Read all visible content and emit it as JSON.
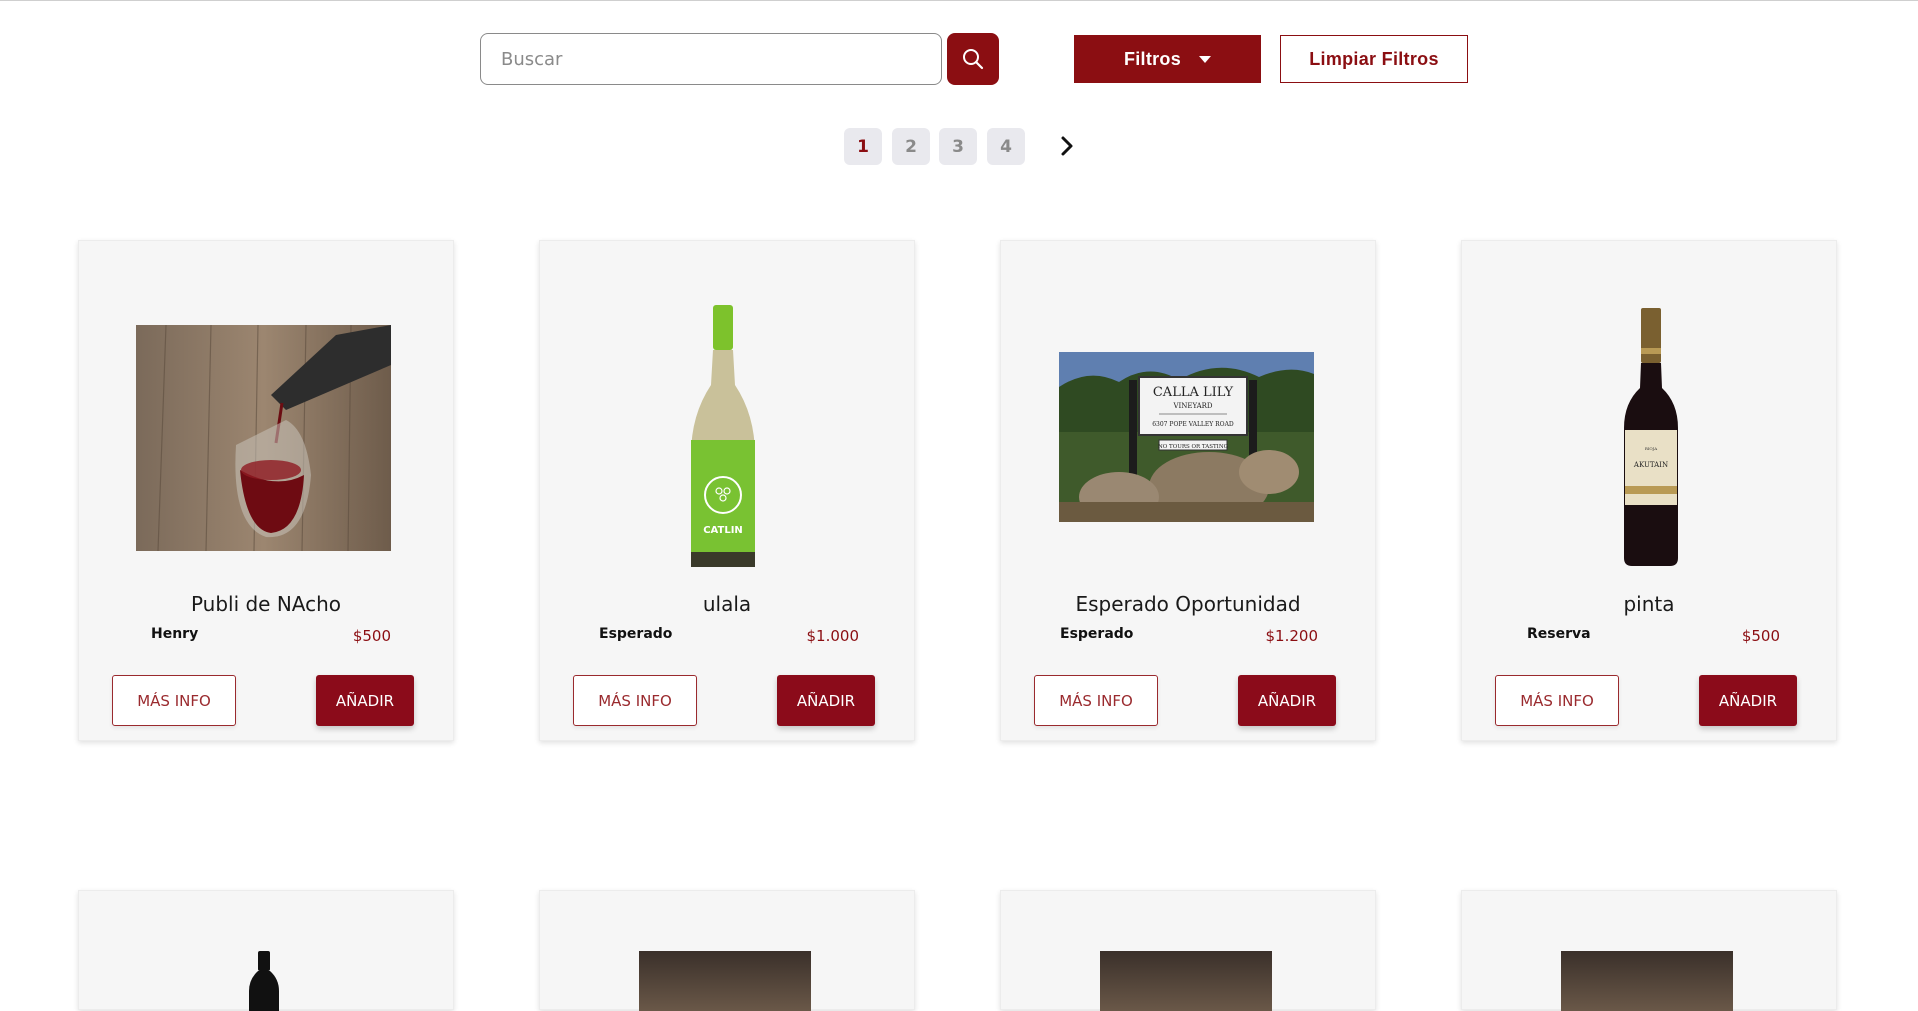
{
  "search": {
    "placeholder": "Buscar"
  },
  "filters": {
    "filtros_label": "Filtros",
    "limpiar_label": "Limpiar Filtros"
  },
  "pagination": {
    "pages": [
      "1",
      "2",
      "3",
      "4"
    ],
    "current": "1"
  },
  "products": [
    {
      "name": "Publi de NAcho",
      "type": "Henry",
      "price": "$500",
      "info_label": "MÁS INFO",
      "add_label": "AÑADIR"
    },
    {
      "name": "ulala",
      "type": "Esperado",
      "price": "$1.000",
      "info_label": "MÁS INFO",
      "add_label": "AÑADIR"
    },
    {
      "name": "Esperado Oportunidad",
      "type": "Esperado",
      "price": "$1.200",
      "info_label": "MÁS INFO",
      "add_label": "AÑADIR"
    },
    {
      "name": "pinta",
      "type": "Reserva",
      "price": "$500",
      "info_label": "MÁS INFO",
      "add_label": "AÑADIR"
    }
  ],
  "images": {
    "calla_sign_line1": "CALLA LILY",
    "calla_sign_line2": "VINEYARD",
    "calla_sign_line3": "6307 POPE VALLEY ROAD",
    "calla_sign_line4": "NO TOURS OR TASTING",
    "catlin_label": "CATLIN",
    "akutain_label": "AKUTAIN"
  },
  "colors": {
    "brand": "#8b0e12",
    "button_add": "#8b0b1a"
  }
}
